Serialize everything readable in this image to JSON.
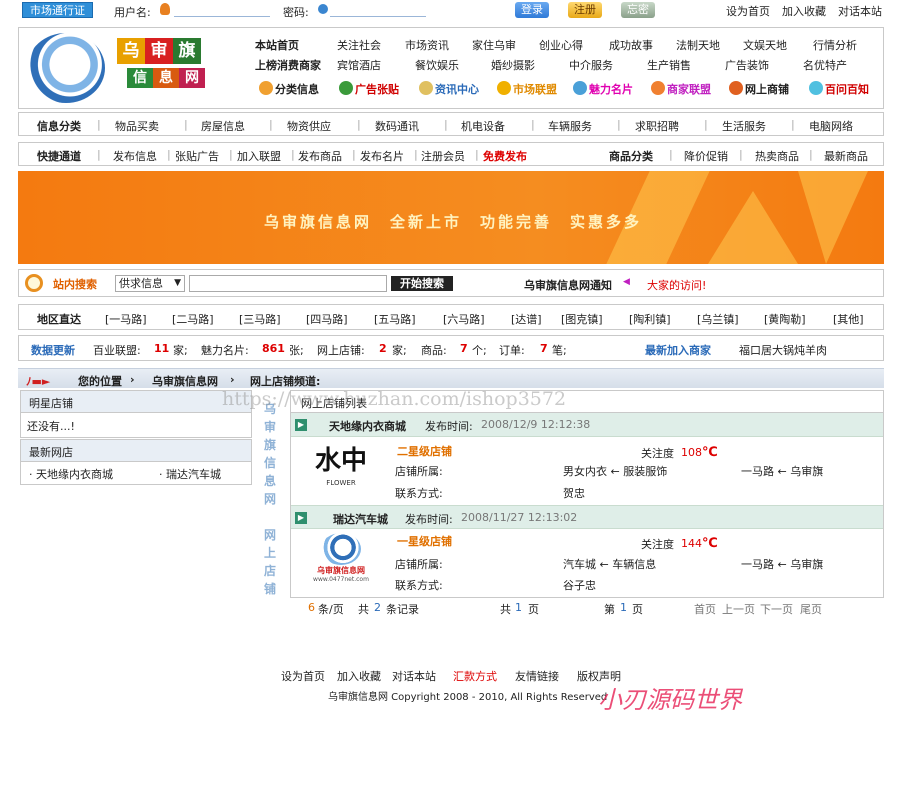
{
  "loginbar": {
    "pass": "市场通行证",
    "user_label": "用户名:",
    "pwd_label": "密码:",
    "btn_login": "登录",
    "btn_register": "注册",
    "btn_forgot": "忘密",
    "links": [
      "设为首页",
      "加入收藏",
      "对话本站"
    ]
  },
  "logo": {
    "chars": [
      "乌",
      "审",
      "旗"
    ],
    "sub": [
      "信",
      "息",
      "网"
    ]
  },
  "nav": {
    "row1": [
      "本站首页",
      "关注社会",
      "市场资讯",
      "家住乌审",
      "创业心得",
      "成功故事",
      "法制天地",
      "文娱天地",
      "行情分析"
    ],
    "row2": [
      "上榜消费商家",
      "宾馆酒店",
      "餐饮娱乐",
      "婚纱摄影",
      "中介服务",
      "生产销售",
      "广告装饰",
      "名优特产"
    ],
    "icons": [
      {
        "label": "分类信息",
        "color": "#2a6ab8",
        "icon": "magnifier-icon"
      },
      {
        "label": "广告张贴",
        "color": "#d00000",
        "icon": "people-icon"
      },
      {
        "label": "资讯中心",
        "color": "#2a6ab8",
        "icon": "notepad-icon"
      },
      {
        "label": "市场联盟",
        "color": "#e08a00",
        "icon": "handshake-icon"
      },
      {
        "label": "魅力名片",
        "color": "#e000b0",
        "icon": "card-icon"
      },
      {
        "label": "商家联盟",
        "color": "#c020c0",
        "icon": "shop-icon"
      },
      {
        "label": "网上商铺",
        "color": "#222222",
        "icon": "globe-icon"
      },
      {
        "label": "百问百知",
        "color": "#d00000",
        "icon": "face-icon"
      }
    ]
  },
  "cat": {
    "title": "信息分类",
    "items": [
      "物品买卖",
      "房屋信息",
      "物资供应",
      "数码通讯",
      "机电设备",
      "车辆服务",
      "求职招聘",
      "生活服务",
      "电脑网络"
    ]
  },
  "quick": {
    "title": "快捷通道",
    "items": [
      "发布信息",
      "张贴广告",
      "加入联盟",
      "发布商品",
      "发布名片",
      "注册会员"
    ],
    "free": "免费发布",
    "prod_title": "商品分类",
    "prod": [
      "降价促销",
      "热卖商品",
      "最新商品"
    ]
  },
  "banner": {
    "text": "乌审旗信息网　全新上市　功能完善　实惠多多"
  },
  "search": {
    "label": "站内搜索",
    "select": "供求信息",
    "button": "开始搜索",
    "notice": "乌审旗信息网通知",
    "notice_tail": "大家的访问!"
  },
  "area": {
    "title": "地区直达",
    "items": [
      "[一马路]",
      "[二马路]",
      "[三马路]",
      "[四马路]",
      "[五马路]",
      "[六马路]",
      "[达谱]",
      "[图克镇]",
      "[陶利镇]",
      "[乌兰镇]",
      "[黄陶勒]",
      "[其他]"
    ]
  },
  "stats": {
    "title": "数据更新",
    "union_label": "百业联盟:",
    "union_count": "11",
    "union_unit": "家;",
    "card_label": "魅力名片:",
    "card_count": "861",
    "card_unit": "张;",
    "shop_label": "网上店铺:",
    "shop_count": "2",
    "shop_unit": "家;",
    "goods_label": "商品:",
    "goods_count": "7",
    "goods_unit": "个;",
    "order_label": "订单:",
    "order_count": "7",
    "order_unit": "笔;",
    "latest_label": "最新加入商家",
    "latest_name": "福口居大锅炖羊肉"
  },
  "crumb": {
    "pos": "您的位置",
    "site": "乌审旗信息网",
    "channel": "网上店铺频道:"
  },
  "sidebar": {
    "star_title": "明星店铺",
    "star_empty": "还没有...!",
    "new_title": "最新网店",
    "new_items": [
      "天地缘内衣商城",
      "瑞达汽车城"
    ]
  },
  "vertical": [
    "乌",
    "审",
    "旗",
    "信",
    "息",
    "网",
    "",
    "网",
    "上",
    "店",
    "铺"
  ],
  "main": {
    "title": "网上店铺列表",
    "shops": [
      {
        "name": "天地缘内衣商城",
        "time_label": "发布时间:",
        "time": "2008/12/9 12:12:38",
        "level": "二星级店铺",
        "heat_label": "关注度",
        "heat": "108",
        "unit": "℃",
        "belong_label": "店铺所属:",
        "cat": "男女内衣 ← 服装服饰",
        "region": "一马路 ← 乌审旗",
        "contact_label": "联系方式:",
        "contact": "贺忠",
        "logo": "水中",
        "logo_sub": "FLOWER"
      },
      {
        "name": "瑞达汽车城",
        "time_label": "发布时间:",
        "time": "2008/11/27 12:13:02",
        "level": "一星级店铺",
        "heat_label": "关注度",
        "heat": "144",
        "unit": "℃",
        "belong_label": "店铺所属:",
        "cat": "汽车城 ← 车辆信息",
        "region": "一马路 ← 乌审旗",
        "contact_label": "联系方式:",
        "contact": "谷子忠",
        "logo": "乌审旗信息网",
        "logo_sub": "www.0477net.com"
      }
    ],
    "pager": {
      "per": "6",
      "per_label": "条/页",
      "total_label": "共",
      "total": "2",
      "total_unit": "条记录",
      "pages_label": "共",
      "pages": "1",
      "pages_unit": "页",
      "cur_label": "第",
      "cur": "1",
      "cur_unit": "页",
      "links": [
        "首页",
        "上一页",
        "下一页",
        "尾页"
      ]
    }
  },
  "footer": {
    "links": [
      "设为首页",
      "加入收藏",
      "对话本站",
      "汇款方式",
      "友情链接",
      "版权声明"
    ],
    "copyright": "乌审旗信息网 Copyright 2008 - 2010, All Rights Reserved"
  },
  "watermark": {
    "url": "https://www.huzhan.com/ishop3572",
    "brand": "小刃源码世界"
  }
}
